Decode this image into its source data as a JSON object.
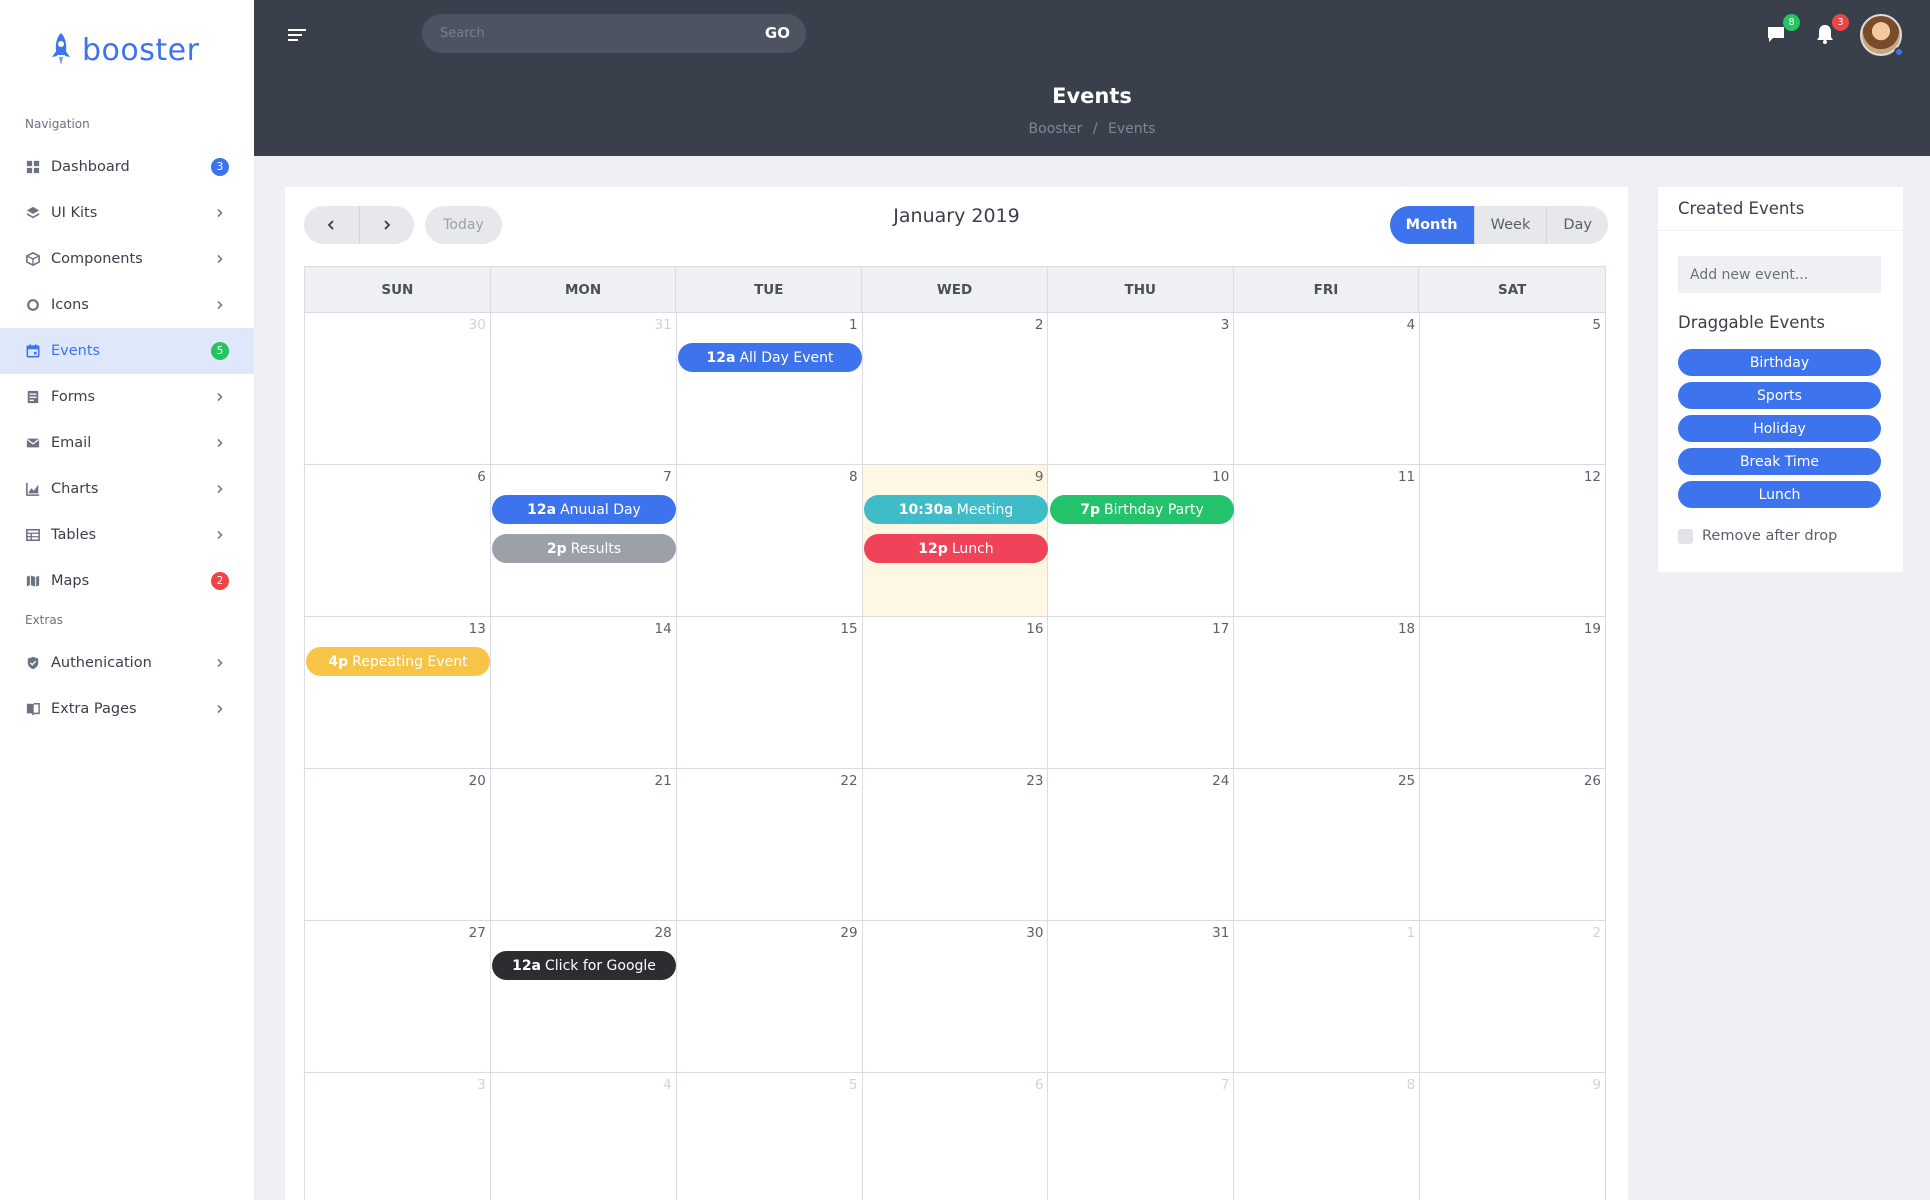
{
  "brand": {
    "name": "booster"
  },
  "sidebar": {
    "sections": [
      {
        "title": "Navigation",
        "items": [
          {
            "label": "Dashboard",
            "icon": "dashboard-icon",
            "badge": "3",
            "badge_color": "#3e73ee",
            "chevron": false,
            "active": false
          },
          {
            "label": "UI Kits",
            "icon": "layers-icon",
            "badge": null,
            "chevron": true,
            "active": false
          },
          {
            "label": "Components",
            "icon": "box-icon",
            "badge": null,
            "chevron": true,
            "active": false
          },
          {
            "label": "Icons",
            "icon": "circle-icon",
            "badge": null,
            "chevron": true,
            "active": false
          },
          {
            "label": "Events",
            "icon": "calendar-icon",
            "badge": "5",
            "badge_color": "#22c55e",
            "chevron": false,
            "active": true
          },
          {
            "label": "Forms",
            "icon": "form-icon",
            "badge": null,
            "chevron": true,
            "active": false
          },
          {
            "label": "Email",
            "icon": "mail-icon",
            "badge": null,
            "chevron": true,
            "active": false
          },
          {
            "label": "Charts",
            "icon": "chart-icon",
            "badge": null,
            "chevron": true,
            "active": false
          },
          {
            "label": "Tables",
            "icon": "table-icon",
            "badge": null,
            "chevron": true,
            "active": false
          },
          {
            "label": "Maps",
            "icon": "map-icon",
            "badge": "2",
            "badge_color": "#ef4444",
            "chevron": false,
            "active": false
          }
        ]
      },
      {
        "title": "Extras",
        "items": [
          {
            "label": "Authenication",
            "icon": "shield-icon",
            "badge": null,
            "chevron": true,
            "active": false
          },
          {
            "label": "Extra Pages",
            "icon": "book-icon",
            "badge": null,
            "chevron": true,
            "active": false
          }
        ]
      }
    ]
  },
  "header": {
    "search_placeholder": "Search",
    "search_button": "GO",
    "messages_count": "8",
    "messages_badge_color": "#22c55e",
    "notifications_count": "3",
    "notifications_badge_color": "#ef4444",
    "title": "Events",
    "breadcrumb": [
      "Booster",
      "Events"
    ],
    "breadcrumb_separator": "/"
  },
  "calendar": {
    "title": "January 2019",
    "today_label": "Today",
    "views": [
      {
        "label": "Month",
        "active": true
      },
      {
        "label": "Week",
        "active": false
      },
      {
        "label": "Day",
        "active": false
      }
    ],
    "weekdays": [
      "SUN",
      "MON",
      "TUE",
      "WED",
      "THU",
      "FRI",
      "SAT"
    ],
    "weeks": [
      [
        {
          "d": "30",
          "other": true
        },
        {
          "d": "31",
          "other": true
        },
        {
          "d": "1"
        },
        {
          "d": "2"
        },
        {
          "d": "3"
        },
        {
          "d": "4"
        },
        {
          "d": "5"
        }
      ],
      [
        {
          "d": "6"
        },
        {
          "d": "7"
        },
        {
          "d": "8"
        },
        {
          "d": "9",
          "today": true
        },
        {
          "d": "10"
        },
        {
          "d": "11"
        },
        {
          "d": "12"
        }
      ],
      [
        {
          "d": "13"
        },
        {
          "d": "14"
        },
        {
          "d": "15"
        },
        {
          "d": "16"
        },
        {
          "d": "17"
        },
        {
          "d": "18"
        },
        {
          "d": "19"
        }
      ],
      [
        {
          "d": "20"
        },
        {
          "d": "21"
        },
        {
          "d": "22"
        },
        {
          "d": "23"
        },
        {
          "d": "24"
        },
        {
          "d": "25"
        },
        {
          "d": "26"
        }
      ],
      [
        {
          "d": "27"
        },
        {
          "d": "28"
        },
        {
          "d": "29"
        },
        {
          "d": "30"
        },
        {
          "d": "31"
        },
        {
          "d": "1",
          "other": true
        },
        {
          "d": "2",
          "other": true
        }
      ],
      [
        {
          "d": "3",
          "other": true
        },
        {
          "d": "4",
          "other": true
        },
        {
          "d": "5",
          "other": true
        },
        {
          "d": "6",
          "other": true
        },
        {
          "d": "7",
          "other": true
        },
        {
          "d": "8",
          "other": true
        },
        {
          "d": "9",
          "other": true
        }
      ]
    ],
    "events": [
      {
        "week": 0,
        "day": 2,
        "slot": 0,
        "time": "12a",
        "title": "All Day Event",
        "color": "#3e73ee"
      },
      {
        "week": 1,
        "day": 1,
        "slot": 0,
        "time": "12a",
        "title": "Anuual Day",
        "color": "#3e73ee"
      },
      {
        "week": 1,
        "day": 1,
        "slot": 1,
        "time": "2p",
        "title": "Results",
        "color": "#9ca0a8"
      },
      {
        "week": 1,
        "day": 3,
        "slot": 0,
        "time": "10:30a",
        "title": "Meeting",
        "color": "#3fbcc7"
      },
      {
        "week": 1,
        "day": 3,
        "slot": 1,
        "time": "12p",
        "title": "Lunch",
        "color": "#f0435a"
      },
      {
        "week": 1,
        "day": 4,
        "slot": 0,
        "time": "7p",
        "title": "Birthday Party",
        "color": "#22c36a"
      },
      {
        "week": 2,
        "day": 0,
        "slot": 0,
        "time": "4p",
        "title": "Repeating Event",
        "color": "#f8c448"
      },
      {
        "week": 4,
        "day": 1,
        "slot": 0,
        "time": "12a",
        "title": "Click for Google",
        "color": "#2b2d31"
      }
    ]
  },
  "created_events": {
    "title": "Created Events",
    "input_placeholder": "Add new event...",
    "draggable_title": "Draggable Events",
    "items": [
      "Birthday",
      "Sports",
      "Holiday",
      "Break Time",
      "Lunch"
    ],
    "item_color": "#3e73ee",
    "remove_label": "Remove after drop"
  }
}
